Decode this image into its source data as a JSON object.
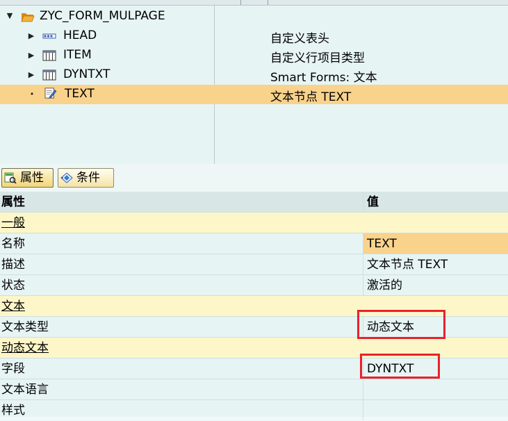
{
  "tree": {
    "root": {
      "label": "ZYC_FORM_MULPAGE"
    },
    "nodes": [
      {
        "label": "HEAD",
        "desc": "自定义表头",
        "icon": "structure-icon"
      },
      {
        "label": "ITEM",
        "desc": "自定义行项目类型",
        "icon": "table-icon"
      },
      {
        "label": "DYNTXT",
        "desc": "Smart Forms: 文本",
        "icon": "table-icon"
      },
      {
        "label": "TEXT",
        "desc": "文本节点 TEXT",
        "icon": "text-edit-icon",
        "selected": true
      }
    ]
  },
  "tabs": [
    {
      "label": "属性",
      "icon": "properties-icon",
      "active": true
    },
    {
      "label": "条件",
      "icon": "conditions-icon",
      "active": false
    }
  ],
  "grid": {
    "header": {
      "label": "属性",
      "value": "值"
    },
    "rows": [
      {
        "type": "group",
        "label": "一般"
      },
      {
        "type": "data",
        "label": "名称",
        "value": "TEXT"
      },
      {
        "type": "data",
        "label": "描述",
        "value": "文本节点 TEXT"
      },
      {
        "type": "data",
        "label": "状态",
        "value": "激活的"
      },
      {
        "type": "group",
        "label": "文本"
      },
      {
        "type": "data",
        "label": "文本类型",
        "value": "动态文本"
      },
      {
        "type": "group",
        "label": "动态文本"
      },
      {
        "type": "data",
        "label": "字段",
        "value": "DYNTXT"
      },
      {
        "type": "data",
        "label": "文本语言",
        "value": ""
      },
      {
        "type": "data",
        "label": "样式",
        "value": ""
      }
    ]
  },
  "colors": {
    "selection": "#f9d28c",
    "annotation_box": "#e8222b"
  }
}
